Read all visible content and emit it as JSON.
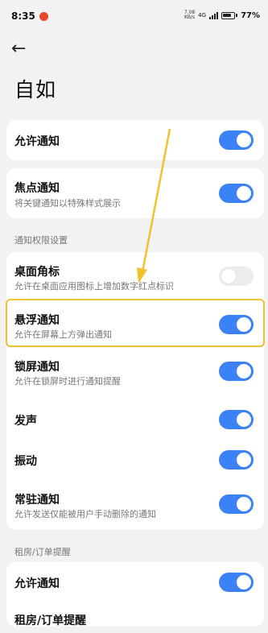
{
  "status_bar": {
    "time": "8:35",
    "net_speed_value": "7.08",
    "net_speed_unit": "KB/s",
    "network_type": "4G",
    "battery": "77%"
  },
  "header": {
    "back_icon": "←",
    "title": "自如"
  },
  "settings": {
    "allow_notifications": {
      "label": "允许通知",
      "on": true
    },
    "focus_notifications": {
      "label": "焦点通知",
      "desc": "将关键通知以特殊样式展示",
      "on": true
    },
    "permissions_header": "通知权限设置",
    "badge": {
      "label": "桌面角标",
      "desc": "允许在桌面应用图标上增加数字红点标识",
      "on": false
    },
    "floating": {
      "label": "悬浮通知",
      "desc": "允许在屏幕上方弹出通知",
      "on": true
    },
    "lockscreen": {
      "label": "锁屏通知",
      "desc": "允许在锁屏时进行通知提醒",
      "on": true
    },
    "sound": {
      "label": "发声",
      "on": true
    },
    "vibrate": {
      "label": "振动",
      "on": true
    },
    "persistent": {
      "label": "常驻通知",
      "desc": "允许发送仅能被用户手动删除的通知",
      "on": true
    },
    "rental_header": "租房/订单提醒",
    "rental_allow": {
      "label": "允许通知",
      "on": true
    },
    "rental_next": {
      "label": "租房/订单提醒"
    }
  },
  "colors": {
    "toggle_on": "#3b82f6",
    "toggle_off": "#ececec",
    "highlight": "#f2c12e",
    "arrow": "#f2c12e"
  }
}
